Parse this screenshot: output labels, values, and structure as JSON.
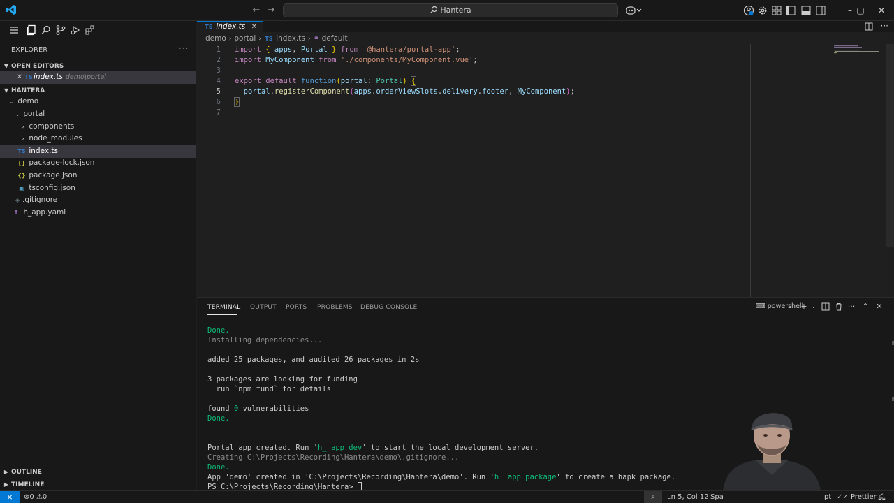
{
  "titlebar": {
    "search_label": "Hantera",
    "window_controls": [
      "–",
      "▢",
      "✕"
    ]
  },
  "sidebar": {
    "title": "EXPLORER",
    "more": "···",
    "open_editors_label": "OPEN EDITORS",
    "open_editor": {
      "icon": "TS",
      "name": "index.ts",
      "path": "demo\\portal"
    },
    "workspace_label": "HANTERA",
    "tree": [
      {
        "label": "demo",
        "type": "folder-open"
      },
      {
        "label": "portal",
        "type": "folder-open"
      },
      {
        "label": "components",
        "type": "folder"
      },
      {
        "label": "node_modules",
        "type": "folder"
      },
      {
        "label": "index.ts",
        "type": "ts",
        "icon": "TS"
      },
      {
        "label": "package-lock.json",
        "type": "json",
        "icon": "{}"
      },
      {
        "label": "package.json",
        "type": "json",
        "icon": "{}"
      },
      {
        "label": "tsconfig.json",
        "type": "tsconfig",
        "icon": "▣"
      },
      {
        "label": ".gitignore",
        "type": "git",
        "icon": "◈"
      },
      {
        "label": "h_app.yaml",
        "type": "yaml",
        "icon": "!"
      }
    ],
    "outline_label": "OUTLINE",
    "timeline_label": "TIMELINE"
  },
  "editor": {
    "tab": {
      "icon": "TS",
      "name": "index.ts"
    },
    "breadcrumb": [
      "demo",
      "portal",
      "index.ts",
      "default"
    ],
    "breadcrumb_ts_icon": "TS",
    "line_numbers": [
      "1",
      "2",
      "3",
      "4",
      "5",
      "6",
      "7"
    ],
    "active_line": 5
  },
  "panel": {
    "tabs": [
      "TERMINAL",
      "OUTPUT",
      "PORTS",
      "PROBLEMS",
      "DEBUG CONSOLE"
    ],
    "active_tab": "TERMINAL",
    "shell": "powershell",
    "terminal_lines": [
      {
        "text": "Done.",
        "style": "green"
      },
      {
        "text": "Installing dependencies...",
        "style": "dim"
      },
      {
        "text": "",
        "style": ""
      },
      {
        "text": "added 25 packages, and audited 26 packages in 2s",
        "style": ""
      },
      {
        "text": "",
        "style": ""
      },
      {
        "text": "3 packages are looking for funding",
        "style": ""
      },
      {
        "text": "  run `npm fund` for details",
        "style": ""
      },
      {
        "text": "",
        "style": ""
      },
      {
        "text": "found 0 vulnerabilities",
        "style": "found"
      },
      {
        "text": "Done.",
        "style": "green"
      },
      {
        "text": "",
        "style": ""
      },
      {
        "text": "",
        "style": ""
      },
      {
        "text": "Portal app created. Run 'h_ app dev' to start the local development server.",
        "style": "run1"
      },
      {
        "text": "Creating C:\\Projects\\Recording\\Hantera\\demo\\.gitignore...",
        "style": "dim"
      },
      {
        "text": "Done.",
        "style": "green"
      },
      {
        "text": "App 'demo' created in 'C:\\Projects\\Recording\\Hantera\\demo'. Run 'h_ app package' to create a hapk package.",
        "style": "run2"
      },
      {
        "text": "PS C:\\Projects\\Recording\\Hantera> ",
        "style": "prompt"
      }
    ],
    "parts": {
      "found_pre": "found ",
      "found_num": "0",
      "found_post": " vulnerabilities",
      "run1_pre": "Portal app created. Run '",
      "run1_cmd": "h_ app dev",
      "run1_post": "' to start the local development server.",
      "run2_pre": "App 'demo' created in 'C:\\Projects\\Recording\\Hantera\\demo'. Run '",
      "run2_cmd": "h_ app package",
      "run2_post": "' to create a hapk package."
    }
  },
  "statusbar": {
    "remote_icon": "⨯",
    "errors": "0",
    "warnings": "0",
    "position": "Ln 5, Col 12",
    "spaces": "Spa",
    "prettier": "Prettier",
    "edge_text": "pt"
  },
  "colors": {
    "accent": "#0078d4",
    "terminal_green": "#0dbc79",
    "ts_blue": "#3178c6"
  }
}
